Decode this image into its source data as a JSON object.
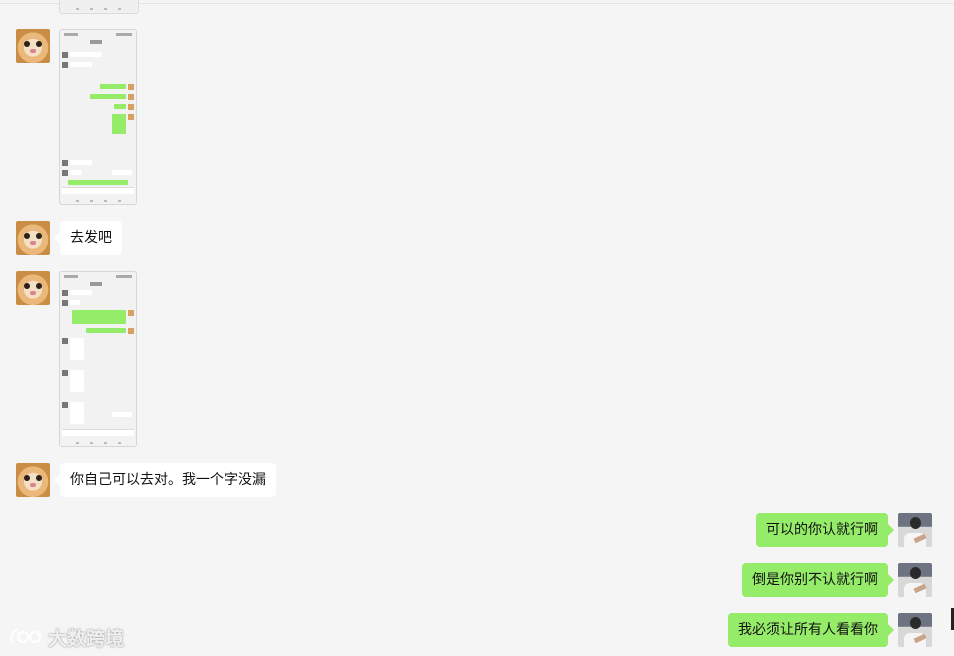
{
  "messages": [
    {
      "type": "image",
      "side": "left",
      "sender": "cat-avatar"
    },
    {
      "type": "text",
      "side": "left",
      "text": "去发吧"
    },
    {
      "type": "image",
      "side": "left",
      "sender": "cat-avatar"
    },
    {
      "type": "text",
      "side": "left",
      "text": "你自己可以去对。我一个字没漏"
    },
    {
      "type": "text",
      "side": "right",
      "text": "可以的你认就行啊"
    },
    {
      "type": "text",
      "side": "right",
      "text": "倒是你别不认就行啊"
    },
    {
      "type": "text",
      "side": "right",
      "text": "我必须让所有人看看你"
    }
  ],
  "watermark": {
    "text": "大数跨境"
  },
  "colors": {
    "background": "#f5f5f5",
    "incoming_bubble": "#ffffff",
    "outgoing_bubble": "#95ec69"
  }
}
